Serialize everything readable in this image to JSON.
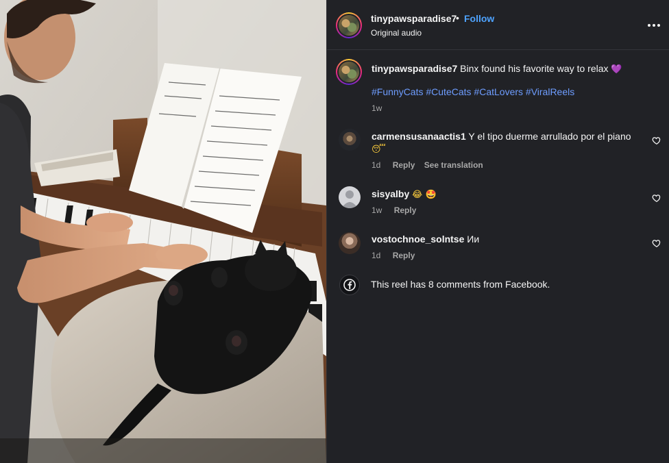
{
  "header": {
    "username": "tinypawsparadise7",
    "separator": "•",
    "follow_label": "Follow",
    "audio_label": "Original audio",
    "more_icon": "more-horizontal-icon"
  },
  "caption": {
    "username": "tinypawsparadise7",
    "text": "Binx found his favorite way to relax",
    "emoji": "💜",
    "hashtags": [
      "#FunnyCats",
      "#CuteCats",
      "#CatLovers",
      "#ViralReels"
    ],
    "time": "1w"
  },
  "comments": [
    {
      "username": "carmensusanaactis1",
      "text": "Y el tipo duerme arrullado por el piano",
      "emoji": "😴",
      "time": "1d",
      "reply_label": "Reply",
      "translate_label": "See translation"
    },
    {
      "username": "sisyalby",
      "text": "",
      "emoji": "😂 🤩",
      "time": "1w",
      "reply_label": "Reply"
    },
    {
      "username": "vostochnoe_solntse",
      "text": "Ии",
      "emoji": "",
      "time": "1d",
      "reply_label": "Reply"
    }
  ],
  "facebook_note": "This reel has 8 comments from Facebook.",
  "colors": {
    "accent_blue": "#4ea3ff",
    "hashtag_blue": "#6e9dff",
    "panel_bg": "#212226",
    "muted_text": "#a8a8a8"
  }
}
